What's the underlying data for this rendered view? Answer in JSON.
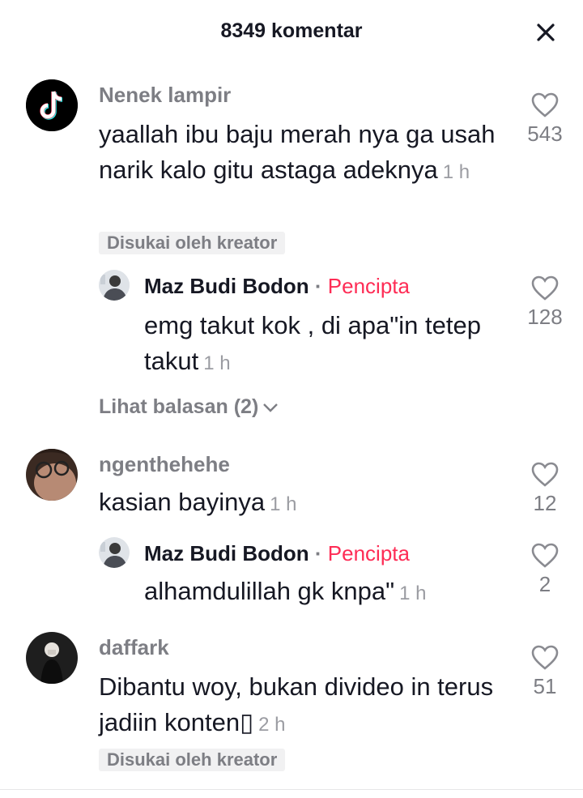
{
  "header": {
    "title": "8349 komentar",
    "close_icon": "close-icon"
  },
  "comments": [
    {
      "username": "Nenek lampir",
      "text": "yaallah ibu baju merah nya ga usah narik kalo gitu astaga adeknya",
      "time": "1 h",
      "likes": "543",
      "badge": "Disukai oleh kreator",
      "reply": {
        "username": "Maz Budi Bodon",
        "separator": "·",
        "role": "Pencipta",
        "text": "emg takut kok , di apa\"in tetep takut",
        "time": "1 h",
        "likes": "128"
      },
      "view_replies": "Lihat balasan (2)"
    },
    {
      "username": "ngenthehehe",
      "text": "kasian bayinya",
      "time": "1 h",
      "likes": "12",
      "reply": {
        "username": "Maz Budi Bodon",
        "separator": "·",
        "role": "Pencipta",
        "text": "alhamdulillah gk knpa\"",
        "time": "1 h",
        "likes": "2"
      }
    },
    {
      "username": "daffark",
      "text": "Dibantu woy, bukan divideo in terus jadiin konten",
      "emoji": "▯",
      "time": "2 h",
      "likes": "51",
      "badge": "Disukai oleh kreator"
    }
  ],
  "colors": {
    "accent": "#fe2c55",
    "text": "#161823",
    "muted": "#7d7e84"
  }
}
